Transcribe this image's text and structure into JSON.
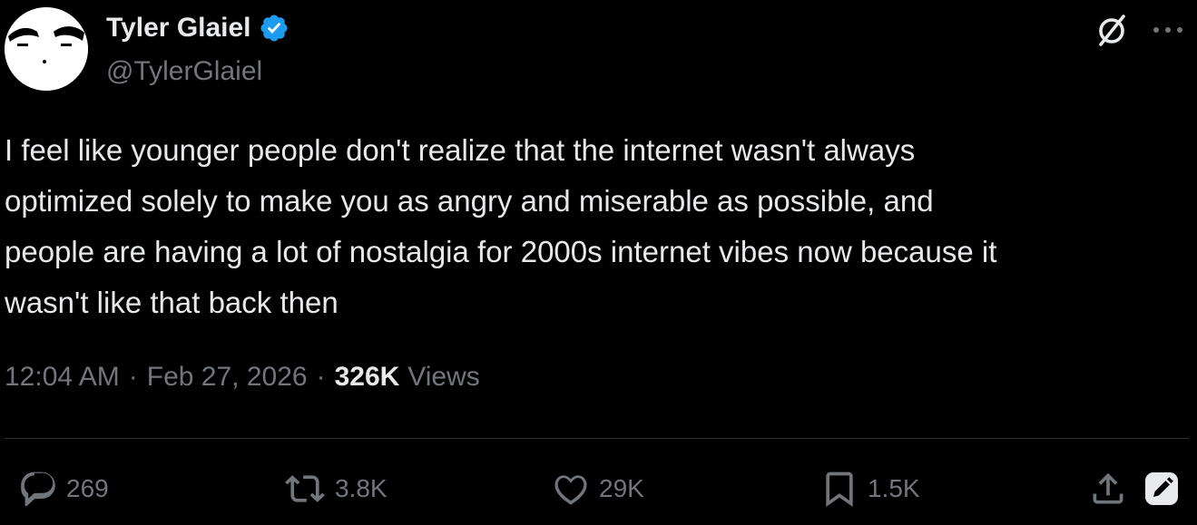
{
  "author": {
    "name": "Tyler Glaiel",
    "handle": "@TylerGlaiel",
    "verified": true
  },
  "tweet": {
    "text_lines": [
      "I feel like younger people don't realize that the internet wasn't always",
      "optimized solely to make you as angry and miserable as possible, and",
      "people are having a lot of nostalgia for 2000s internet vibes now because it",
      "wasn't like that back then"
    ],
    "time": "12:04 AM",
    "separator": "·",
    "date": "Feb 27, 2026",
    "views_count": "326K",
    "views_label": "Views"
  },
  "actions": {
    "replies": "269",
    "reposts": "3.8K",
    "likes": "29K",
    "bookmarks": "1.5K"
  },
  "icons": {
    "grok": "grok-icon",
    "more": "more-icon",
    "reply": "reply-icon",
    "repost": "repost-icon",
    "like": "heart-icon",
    "bookmark": "bookmark-icon",
    "share": "share-icon",
    "edit": "edit-icon"
  },
  "colors": {
    "background": "#000000",
    "text_primary": "#e7e9ea",
    "text_secondary": "#71767b",
    "verified_blue": "#1d9bf0",
    "divider": "#2f3336"
  }
}
